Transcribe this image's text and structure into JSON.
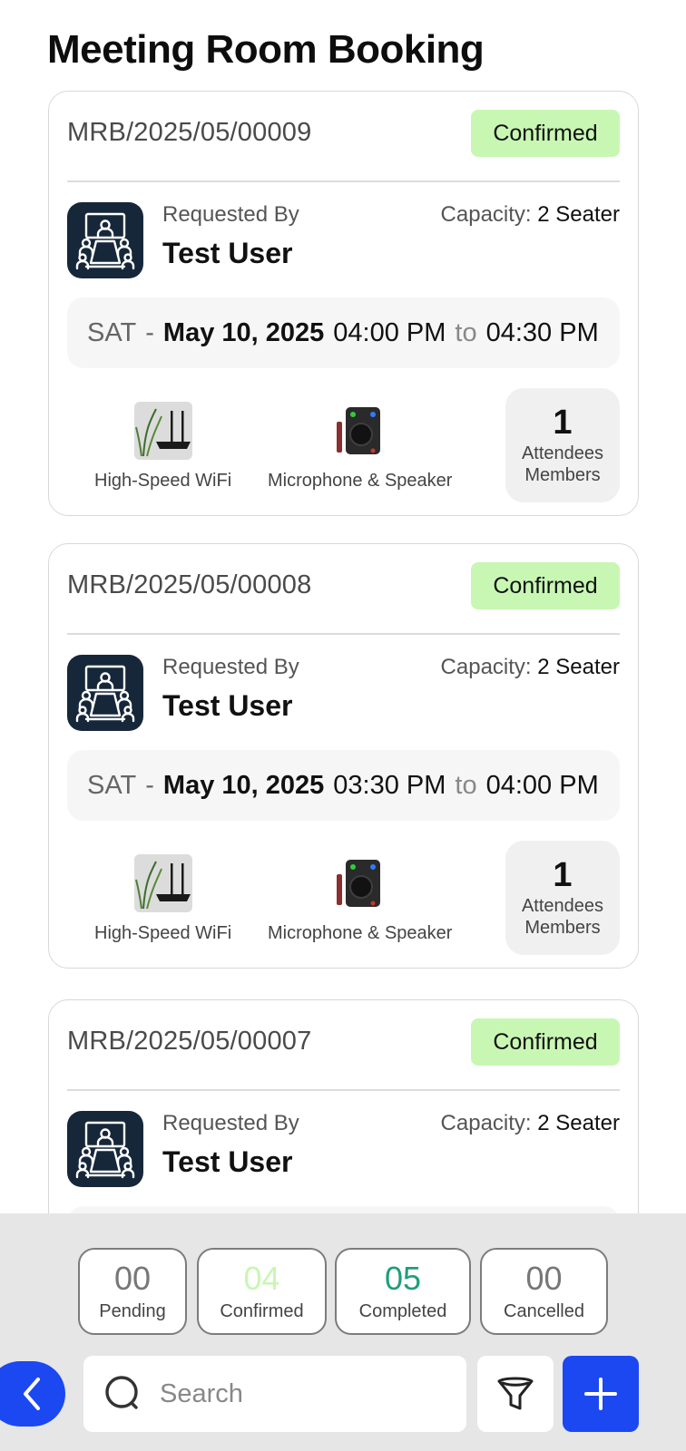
{
  "page": {
    "title": "Meeting Room Booking"
  },
  "bookings": [
    {
      "id": "MRB/2025/05/00009",
      "status": "Confirmed",
      "requested_by_label": "Requested By",
      "requested_by": "Test User",
      "capacity_label": "Capacity:",
      "capacity_value": "2 Seater",
      "day": "SAT",
      "dash": "-",
      "date": "May 10, 2025",
      "start": "04:00 PM",
      "to": "to",
      "end": "04:30 PM",
      "amenities": [
        {
          "icon": "wifi-router-icon",
          "label": "High-Speed WiFi"
        },
        {
          "icon": "speaker-icon",
          "label": "Microphone & Speaker"
        }
      ],
      "attendees_count": "1",
      "attendees_label": "Attendees",
      "members_label": "Members"
    },
    {
      "id": "MRB/2025/05/00008",
      "status": "Confirmed",
      "requested_by_label": "Requested By",
      "requested_by": "Test User",
      "capacity_label": "Capacity:",
      "capacity_value": "2 Seater",
      "day": "SAT",
      "dash": "-",
      "date": "May 10, 2025",
      "start": "03:30 PM",
      "to": "to",
      "end": "04:00 PM",
      "amenities": [
        {
          "icon": "wifi-router-icon",
          "label": "High-Speed WiFi"
        },
        {
          "icon": "speaker-icon",
          "label": "Microphone & Speaker"
        }
      ],
      "attendees_count": "1",
      "attendees_label": "Attendees",
      "members_label": "Members"
    },
    {
      "id": "MRB/2025/05/00007",
      "status": "Confirmed",
      "requested_by_label": "Requested By",
      "requested_by": "Test User",
      "capacity_label": "Capacity:",
      "capacity_value": "2 Seater"
    }
  ],
  "stats": [
    {
      "value": "00",
      "label": "Pending",
      "color": "#777777"
    },
    {
      "value": "04",
      "label": "Confirmed",
      "color": "#c8f7b4"
    },
    {
      "value": "05",
      "label": "Completed",
      "color": "#1f9e7a"
    },
    {
      "value": "00",
      "label": "Cancelled",
      "color": "#777777"
    }
  ],
  "search": {
    "placeholder": "Search"
  },
  "icons": {
    "back": "chevron-left-icon",
    "search": "search-icon",
    "filter": "filter-icon",
    "add": "plus-icon",
    "avatar": "meeting-room-icon"
  },
  "colors": {
    "accent": "#1c48f2",
    "status_confirmed_bg": "#c8f7b4",
    "avatar_bg": "#16273a"
  }
}
